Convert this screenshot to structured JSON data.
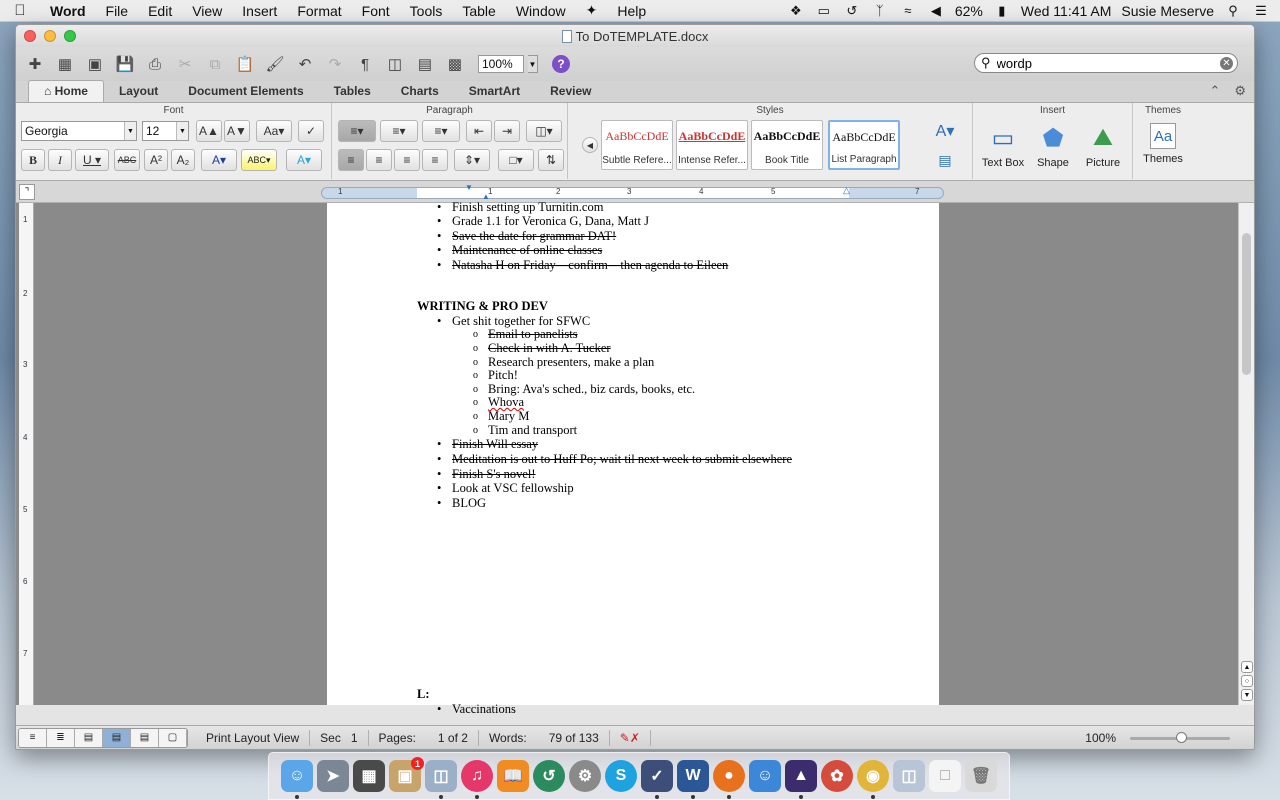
{
  "menubar": {
    "app": "Word",
    "items": [
      "File",
      "Edit",
      "View",
      "Insert",
      "Format",
      "Font",
      "Tools",
      "Table",
      "Window",
      "Help"
    ],
    "battery": "62%",
    "clock": "Wed 11:41 AM",
    "user": "Susie Meserve"
  },
  "window": {
    "title": "To DoTEMPLATE.docx"
  },
  "toolbar": {
    "zoom": "100%",
    "help": "?",
    "search_value": "wordp"
  },
  "tabs": [
    "Home",
    "Layout",
    "Document Elements",
    "Tables",
    "Charts",
    "SmartArt",
    "Review"
  ],
  "ribbon": {
    "font_group": "Font",
    "font_name": "Georgia",
    "font_size": "12",
    "paragraph_group": "Paragraph",
    "styles_group": "Styles",
    "styles": [
      {
        "preview": "AaBbCcDdE",
        "name": "Subtle Refere..."
      },
      {
        "preview": "AaBbCcDdE",
        "name": "Intense Refer..."
      },
      {
        "preview": "AaBbCcDdE",
        "name": "Book Title"
      },
      {
        "preview": "AaBbCcDdE",
        "name": "List Paragraph"
      }
    ],
    "insert_group": "Insert",
    "insert_items": [
      "Text Box",
      "Shape",
      "Picture"
    ],
    "themes_group": "Themes",
    "themes_label": "Themes"
  },
  "ruler": {
    "numbers": [
      "1",
      "1",
      "2",
      "3",
      "4",
      "5",
      "7"
    ],
    "vertical_numbers": [
      "1",
      "2",
      "3",
      "4",
      "5",
      "6",
      "7"
    ]
  },
  "document": {
    "top_items": [
      {
        "text": "Finish setting up Turnitin.com",
        "done": false
      },
      {
        "text": "Grade 1.1 for Veronica G, Dana, Matt J",
        "done": false
      },
      {
        "text": "Save the date for grammar DAT!",
        "done": true
      },
      {
        "text": "Maintenance of online classes",
        "done": true
      },
      {
        "text": "Natasha H on Friday—confirm—then agenda to Eileen",
        "done": true
      }
    ],
    "heading": "WRITING & PRO DEV",
    "main_item": "Get shit together for SFWC",
    "sub_items": [
      {
        "text": "Email to panelists",
        "done": true
      },
      {
        "text": "Check in with A. Tucker",
        "done": true
      },
      {
        "text": "Research presenters, make a plan",
        "done": false
      },
      {
        "text": "Pitch!",
        "done": false
      },
      {
        "text": "Bring: Ava's sched., biz cards, books, etc.",
        "done": false
      },
      {
        "text": "Whova",
        "done": false
      },
      {
        "text": "Mary M",
        "done": false
      },
      {
        "text": "Tim and transport",
        "done": false
      }
    ],
    "more_items": [
      {
        "text": "Finish Will essay",
        "done": true
      },
      {
        "text": "Meditation is out to Huff Po; wait til next week to submit elsewhere",
        "done": true
      },
      {
        "text": "Finish S's novel!",
        "done": true
      },
      {
        "text": "Look at VSC fellowship",
        "done": false
      },
      {
        "text": "BLOG",
        "done": false
      }
    ],
    "heading2": "L:",
    "last_item": "Vaccinations"
  },
  "statusbar": {
    "view": "Print Layout View",
    "sec_label": "Sec",
    "sec": "1",
    "pages_label": "Pages:",
    "pages": "1 of 2",
    "words_label": "Words:",
    "words": "79 of 133",
    "zoom": "100%"
  },
  "dock": {
    "apps": [
      "finder-icon",
      "launchpad-icon",
      "calculator-icon",
      "photo-icon",
      "preview-icon",
      "itunes-icon",
      "ibooks-icon",
      "time-machine-icon",
      "system-preferences-icon",
      "skype-icon",
      "egp-icon",
      "word-icon",
      "firefox-icon",
      "contacts-icon",
      "app-icon",
      "picasa-icon",
      "chrome-icon",
      "preview2-icon",
      "document-icon",
      "trash-icon"
    ],
    "badge": "1"
  }
}
